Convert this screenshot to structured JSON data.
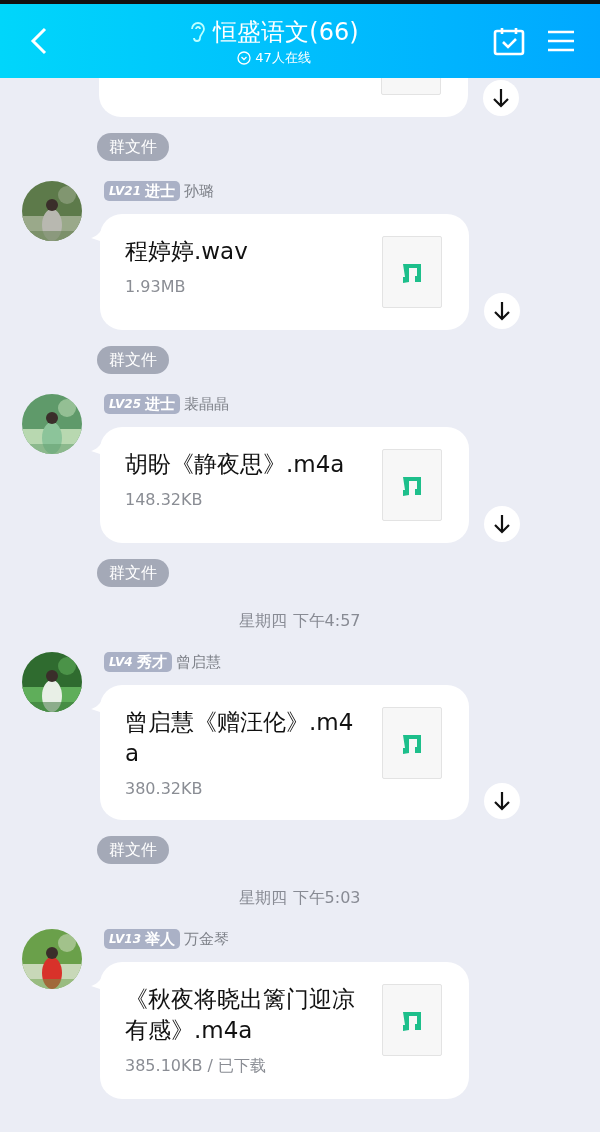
{
  "header": {
    "title": "恒盛语文(66)",
    "online": "47人在线"
  },
  "feed": [
    {
      "kind": "partial_file",
      "downloadable": true
    },
    {
      "kind": "tag",
      "text": "群文件"
    },
    {
      "kind": "message",
      "level": "LV21",
      "rank": "进士",
      "name": "孙璐",
      "file": "程婷婷.wav",
      "size": "1.93MB",
      "downloadable": true
    },
    {
      "kind": "tag",
      "text": "群文件"
    },
    {
      "kind": "message",
      "level": "LV25",
      "rank": "进士",
      "name": "裴晶晶",
      "file": "胡盼《静夜思》.m4a",
      "size": "148.32KB",
      "downloadable": true
    },
    {
      "kind": "tag",
      "text": "群文件"
    },
    {
      "kind": "time",
      "text": "星期四 下午4:57"
    },
    {
      "kind": "message",
      "level": "LV4",
      "rank": "秀才",
      "name": "曾启慧",
      "file": "曾启慧《赠汪伦》.m4a",
      "size": "380.32KB",
      "downloadable": true
    },
    {
      "kind": "tag",
      "text": "群文件"
    },
    {
      "kind": "time",
      "text": "星期四 下午5:03"
    },
    {
      "kind": "message",
      "level": "LV13",
      "rank": "举人",
      "name": "万金琴",
      "file": "《秋夜将晓出篱门迎凉有感》.m4a",
      "size": "385.10KB / 已下载",
      "downloadable": false
    }
  ]
}
